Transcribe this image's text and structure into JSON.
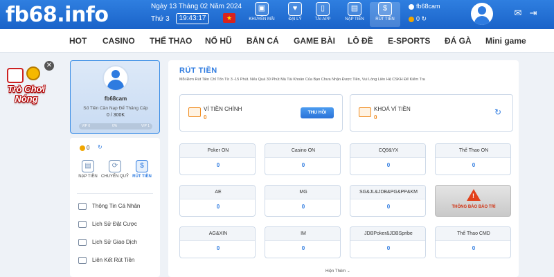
{
  "header": {
    "logo": "fb68.info",
    "date": "Ngày 13 Tháng 02 Năm 2024",
    "day_of_week": "Thứ 3",
    "time": "19:43:17",
    "nav": [
      {
        "label": "KHUYẾN MÃI",
        "icon": "gift-icon"
      },
      {
        "label": "ĐẠI LÝ",
        "icon": "handshake-icon"
      },
      {
        "label": "TẢI APP",
        "icon": "phone-icon"
      },
      {
        "label": "NẠP TIỀN",
        "icon": "wallet-icon"
      },
      {
        "label": "RÚT TIỀN",
        "icon": "moneybag-icon"
      }
    ],
    "account": "fb68cam",
    "balance": "0",
    "colors": {
      "primary": "#1a63c9",
      "accent": "#f08b1f"
    }
  },
  "mainnav": [
    "HOT",
    "CASINO",
    "THỂ THAO",
    "NỔ HŨ",
    "BẮN CÁ",
    "GAME BÀI",
    "LÔ ĐỀ",
    "E-SPORTS",
    "ĐÁ GÀ",
    "Mini game"
  ],
  "promo": {
    "text": "Trò Chơi Nóng"
  },
  "profile": {
    "username": "fb68cam",
    "upgrade_label": "Số Tiền Cần Nạp Để Thăng Cấp",
    "progress": "0 / 300K",
    "vip_current": "VIP 0",
    "percent": "0%",
    "vip_next": "VIP 1"
  },
  "sidebar": {
    "balance": "0",
    "actions": [
      {
        "label": "NẠP TIỀN",
        "active": false
      },
      {
        "label": "CHUYỂN QUỸ",
        "active": false
      },
      {
        "label": "RÚT TIỀN",
        "active": true
      }
    ],
    "menu": [
      "Thông Tin Cá Nhân",
      "Lịch Sử Đặt Cược",
      "Lịch Sử Giao Dịch",
      "Liên Kết Rút Tiền"
    ]
  },
  "content": {
    "title": "RÚT TIỀN",
    "notice": "Mỗi Đơn Rút Tiền Chỉ Tốn Từ 3 -15 Phút. Nếu Quá 30 Phút Mà Tài Khoản Của Bạn Chưa Nhận Được Tiền, Vui Lòng Liên Hệ CSKH Để Kiểm Tra",
    "main_wallet": {
      "label": "VÍ TIỀN CHÍNH",
      "value": "0",
      "button": "THU HỒI"
    },
    "locked_wallet": {
      "label": "KHOÁ VÍ TIỀN",
      "value": "0"
    },
    "games": [
      {
        "name": "Poker ON",
        "value": "0"
      },
      {
        "name": "Casino ON",
        "value": "0"
      },
      {
        "name": "CQ9&YX",
        "value": "0"
      },
      {
        "name": "Thể Thao ON",
        "value": "0"
      },
      {
        "name": "AE",
        "value": "0"
      },
      {
        "name": "MG",
        "value": "0"
      },
      {
        "name": "SG&JL&JDB&PG&PP&KM",
        "value": "0"
      },
      {
        "name": "AG&XIN",
        "value": "0"
      },
      {
        "name": "IM",
        "value": "0"
      },
      {
        "name": "JDBPoker&JDBSpribe",
        "value": "0"
      },
      {
        "name": "Thể Thao CMD",
        "value": "0"
      }
    ],
    "maintenance": "THÔNG BÁO BẢO TRÌ",
    "show_more": "Hiện Thêm"
  }
}
